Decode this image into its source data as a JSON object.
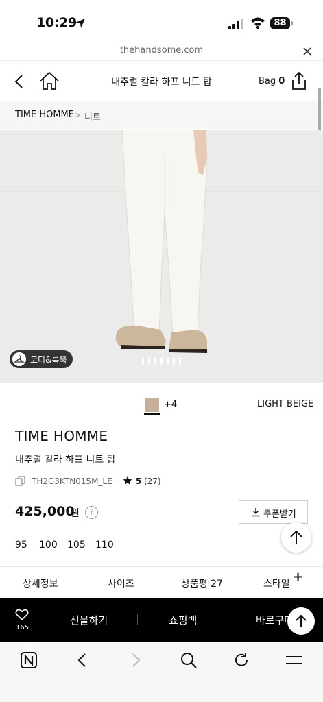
{
  "status": {
    "time": "10:29",
    "battery": "88"
  },
  "browser": {
    "url": "thehandsome.com"
  },
  "header": {
    "title": "내추럴 칼라 하프 니트 탑",
    "bag_label": "Bag",
    "bag_count": "0"
  },
  "breadcrumb": {
    "brand": "TIME HOMME",
    "separator": ">",
    "category": "니트"
  },
  "image": {
    "coordi_label": "코디&룩북",
    "dot_count": 7
  },
  "color": {
    "more": "+4",
    "name": "LIGHT BEIGE",
    "swatch": "#c7b09a"
  },
  "product": {
    "brand": "TIME HOMME",
    "name": "내추럴 칼라 하프 니트 탑",
    "code": "TH2G3KTN015M_LE",
    "code_dot": "·",
    "rating": "5",
    "review_count": "(27)",
    "price": "425,000",
    "price_unit": "원",
    "info": "?",
    "coupon_label": "쿠폰받기",
    "sizes": [
      "95",
      "100",
      "105",
      "110"
    ]
  },
  "tabs": {
    "detail": "상세정보",
    "size": "사이즈",
    "review": "상품평 27",
    "style": "스타일",
    "style_plus": "+"
  },
  "bottom_bar": {
    "wish_count": "165",
    "gift": "선물하기",
    "cart": "쇼핑백",
    "buy": "바로구매"
  }
}
